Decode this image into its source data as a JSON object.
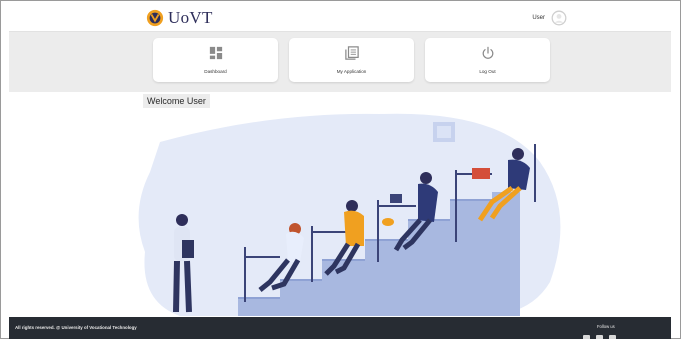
{
  "header": {
    "logo_text": "UoVT",
    "user_name": "User",
    "logo_icon": "uovt-logo",
    "avatar_icon": "user-avatar-icon"
  },
  "nav": {
    "cards": [
      {
        "label": "Dashboard",
        "icon": "dashboard-icon"
      },
      {
        "label": "My Application",
        "icon": "application-icon"
      },
      {
        "label": "Log Out",
        "icon": "power-icon"
      }
    ]
  },
  "main": {
    "welcome": "Welcome User"
  },
  "footer": {
    "copyright": "All rights reserved. @ University of Vocational Technology",
    "follow_label": "Follow us",
    "social_icons": [
      "facebook-icon",
      "twitter-icon",
      "youtube-icon"
    ]
  },
  "colors": {
    "accent": "#f0a020",
    "brand_dark": "#2e2e5a",
    "nav_band": "#ececec",
    "footer_bg": "#272c33",
    "illustration_blob": "#e4eaf8",
    "stairs": "#a8b8e0"
  }
}
